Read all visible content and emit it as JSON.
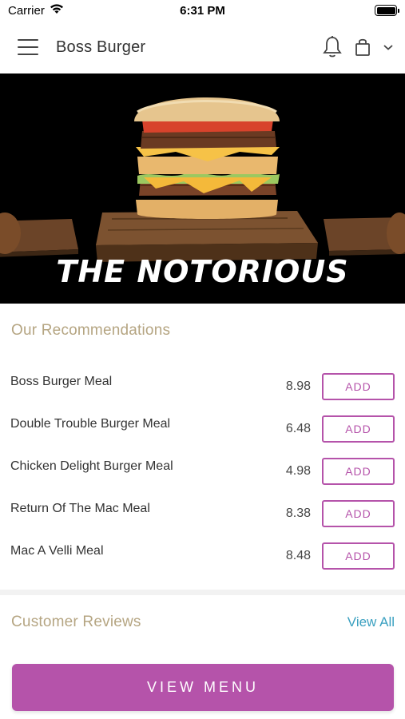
{
  "status_bar": {
    "carrier": "Carrier",
    "time": "6:31 PM"
  },
  "header": {
    "title": "Boss Burger"
  },
  "hero": {
    "title": "THE NOTORIOUS"
  },
  "recommendations": {
    "title": "Our Recommendations",
    "items": [
      {
        "name": "Boss Burger Meal",
        "price": "8.98",
        "button": "ADD"
      },
      {
        "name": "Double Trouble Burger Meal",
        "price": "6.48",
        "button": "ADD"
      },
      {
        "name": "Chicken Delight Burger Meal",
        "price": "4.98",
        "button": "ADD"
      },
      {
        "name": "Return Of The Mac Meal",
        "price": "8.38",
        "button": "ADD"
      },
      {
        "name": "Mac A Velli Meal",
        "price": "8.48",
        "button": "ADD"
      }
    ]
  },
  "reviews": {
    "title": "Customer Reviews",
    "view_all": "View All"
  },
  "footer": {
    "view_menu": "VIEW MENU"
  },
  "colors": {
    "accent": "#b553aa",
    "section_title": "#b5a582",
    "link": "#3aa0c0"
  }
}
